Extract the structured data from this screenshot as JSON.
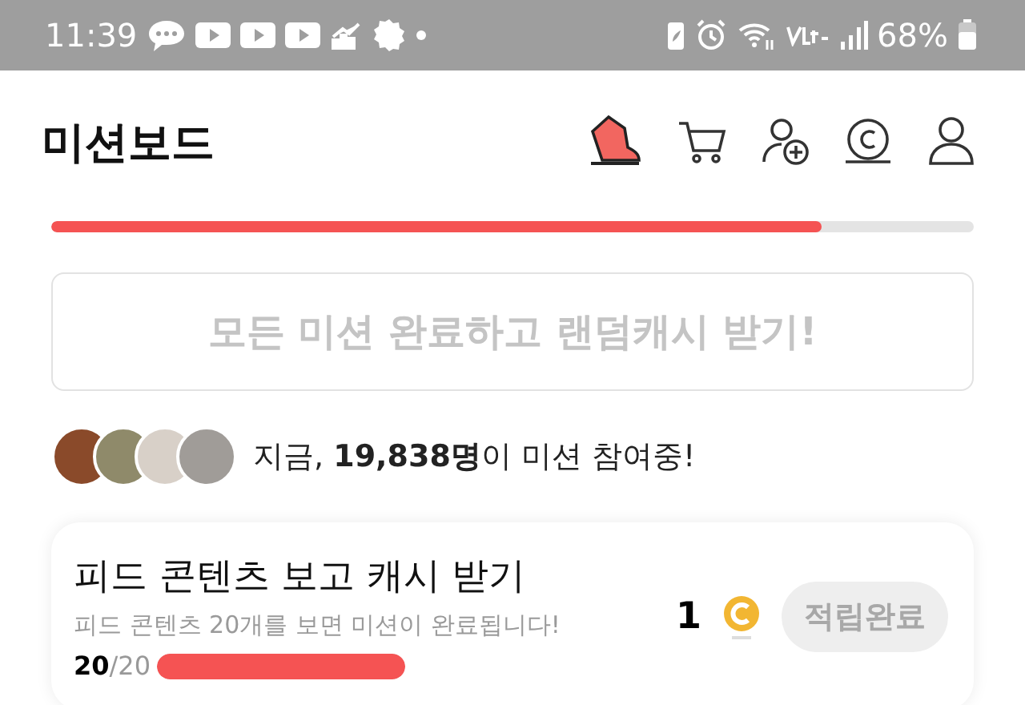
{
  "status_bar": {
    "time": "11:39",
    "battery": "68%"
  },
  "app_bar": {
    "title": "미션보드"
  },
  "overall_progress": {
    "level": 0.835
  },
  "complete_all_button": {
    "label": "모든 미션 완료하고 랜덤캐시 받기!",
    "disabled": true
  },
  "participants": {
    "text": "지금, **19,838명**이 미션 참여중!"
  },
  "missions": [
    {
      "title": "피드 콘텐츠 보고 캐시 받기",
      "description": "피드 콘텐츠 20개를 보면 미션이 완료됩니다!",
      "count": "20",
      "total": "/20",
      "level": 1,
      "reward": "1",
      "button": {
        "label": "적립완료",
        "disabled": true
      }
    }
  ]
}
